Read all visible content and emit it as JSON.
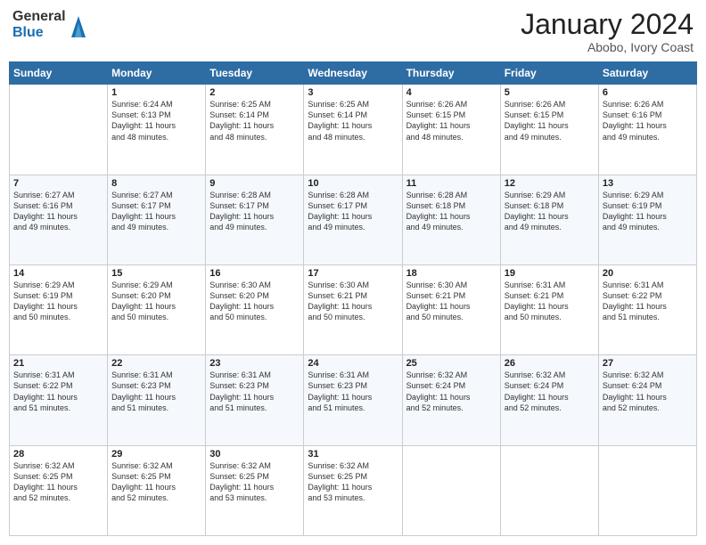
{
  "logo": {
    "general": "General",
    "blue": "Blue"
  },
  "title": {
    "month": "January 2024",
    "location": "Abobo, Ivory Coast"
  },
  "days_of_week": [
    "Sunday",
    "Monday",
    "Tuesday",
    "Wednesday",
    "Thursday",
    "Friday",
    "Saturday"
  ],
  "weeks": [
    [
      {
        "day": "",
        "info": ""
      },
      {
        "day": "1",
        "info": "Sunrise: 6:24 AM\nSunset: 6:13 PM\nDaylight: 11 hours\nand 48 minutes."
      },
      {
        "day": "2",
        "info": "Sunrise: 6:25 AM\nSunset: 6:14 PM\nDaylight: 11 hours\nand 48 minutes."
      },
      {
        "day": "3",
        "info": "Sunrise: 6:25 AM\nSunset: 6:14 PM\nDaylight: 11 hours\nand 48 minutes."
      },
      {
        "day": "4",
        "info": "Sunrise: 6:26 AM\nSunset: 6:15 PM\nDaylight: 11 hours\nand 48 minutes."
      },
      {
        "day": "5",
        "info": "Sunrise: 6:26 AM\nSunset: 6:15 PM\nDaylight: 11 hours\nand 49 minutes."
      },
      {
        "day": "6",
        "info": "Sunrise: 6:26 AM\nSunset: 6:16 PM\nDaylight: 11 hours\nand 49 minutes."
      }
    ],
    [
      {
        "day": "7",
        "info": "Sunrise: 6:27 AM\nSunset: 6:16 PM\nDaylight: 11 hours\nand 49 minutes."
      },
      {
        "day": "8",
        "info": "Sunrise: 6:27 AM\nSunset: 6:17 PM\nDaylight: 11 hours\nand 49 minutes."
      },
      {
        "day": "9",
        "info": "Sunrise: 6:28 AM\nSunset: 6:17 PM\nDaylight: 11 hours\nand 49 minutes."
      },
      {
        "day": "10",
        "info": "Sunrise: 6:28 AM\nSunset: 6:17 PM\nDaylight: 11 hours\nand 49 minutes."
      },
      {
        "day": "11",
        "info": "Sunrise: 6:28 AM\nSunset: 6:18 PM\nDaylight: 11 hours\nand 49 minutes."
      },
      {
        "day": "12",
        "info": "Sunrise: 6:29 AM\nSunset: 6:18 PM\nDaylight: 11 hours\nand 49 minutes."
      },
      {
        "day": "13",
        "info": "Sunrise: 6:29 AM\nSunset: 6:19 PM\nDaylight: 11 hours\nand 49 minutes."
      }
    ],
    [
      {
        "day": "14",
        "info": "Sunrise: 6:29 AM\nSunset: 6:19 PM\nDaylight: 11 hours\nand 50 minutes."
      },
      {
        "day": "15",
        "info": "Sunrise: 6:29 AM\nSunset: 6:20 PM\nDaylight: 11 hours\nand 50 minutes."
      },
      {
        "day": "16",
        "info": "Sunrise: 6:30 AM\nSunset: 6:20 PM\nDaylight: 11 hours\nand 50 minutes."
      },
      {
        "day": "17",
        "info": "Sunrise: 6:30 AM\nSunset: 6:21 PM\nDaylight: 11 hours\nand 50 minutes."
      },
      {
        "day": "18",
        "info": "Sunrise: 6:30 AM\nSunset: 6:21 PM\nDaylight: 11 hours\nand 50 minutes."
      },
      {
        "day": "19",
        "info": "Sunrise: 6:31 AM\nSunset: 6:21 PM\nDaylight: 11 hours\nand 50 minutes."
      },
      {
        "day": "20",
        "info": "Sunrise: 6:31 AM\nSunset: 6:22 PM\nDaylight: 11 hours\nand 51 minutes."
      }
    ],
    [
      {
        "day": "21",
        "info": "Sunrise: 6:31 AM\nSunset: 6:22 PM\nDaylight: 11 hours\nand 51 minutes."
      },
      {
        "day": "22",
        "info": "Sunrise: 6:31 AM\nSunset: 6:23 PM\nDaylight: 11 hours\nand 51 minutes."
      },
      {
        "day": "23",
        "info": "Sunrise: 6:31 AM\nSunset: 6:23 PM\nDaylight: 11 hours\nand 51 minutes."
      },
      {
        "day": "24",
        "info": "Sunrise: 6:31 AM\nSunset: 6:23 PM\nDaylight: 11 hours\nand 51 minutes."
      },
      {
        "day": "25",
        "info": "Sunrise: 6:32 AM\nSunset: 6:24 PM\nDaylight: 11 hours\nand 52 minutes."
      },
      {
        "day": "26",
        "info": "Sunrise: 6:32 AM\nSunset: 6:24 PM\nDaylight: 11 hours\nand 52 minutes."
      },
      {
        "day": "27",
        "info": "Sunrise: 6:32 AM\nSunset: 6:24 PM\nDaylight: 11 hours\nand 52 minutes."
      }
    ],
    [
      {
        "day": "28",
        "info": "Sunrise: 6:32 AM\nSunset: 6:25 PM\nDaylight: 11 hours\nand 52 minutes."
      },
      {
        "day": "29",
        "info": "Sunrise: 6:32 AM\nSunset: 6:25 PM\nDaylight: 11 hours\nand 52 minutes."
      },
      {
        "day": "30",
        "info": "Sunrise: 6:32 AM\nSunset: 6:25 PM\nDaylight: 11 hours\nand 53 minutes."
      },
      {
        "day": "31",
        "info": "Sunrise: 6:32 AM\nSunset: 6:25 PM\nDaylight: 11 hours\nand 53 minutes."
      },
      {
        "day": "",
        "info": ""
      },
      {
        "day": "",
        "info": ""
      },
      {
        "day": "",
        "info": ""
      }
    ]
  ]
}
